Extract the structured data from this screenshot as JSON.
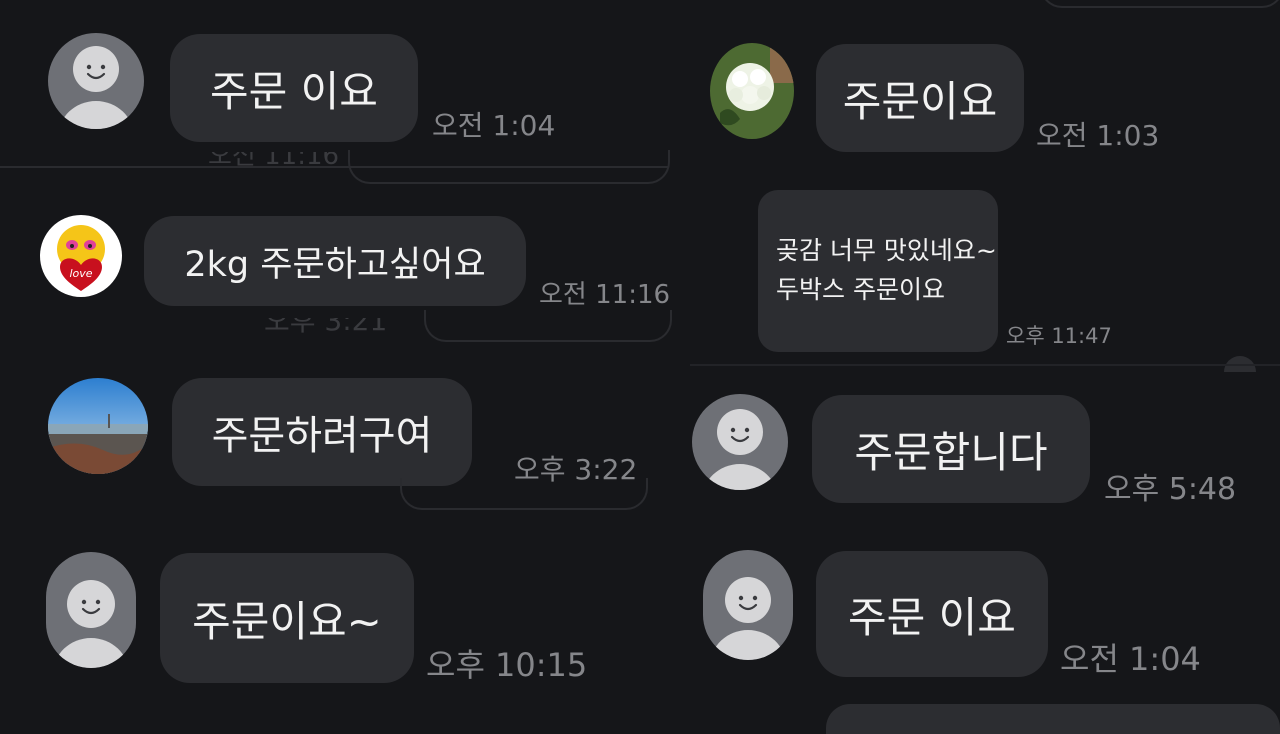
{
  "colors": {
    "background": "#151619",
    "bubble": "#2c2d31",
    "bubble_text": "#f2f2f2",
    "timestamp": "#85868a",
    "default_avatar": "#6e7076"
  },
  "left": {
    "messages": [
      {
        "text": "주문 이요",
        "time": "오전 1:04",
        "avatar": "default-person-icon"
      },
      {
        "text": "2kg 주문하고싶어요",
        "time": "오전 11:16",
        "avatar": "love-heart-emoji"
      },
      {
        "text": "주문하려구여",
        "time": "오후 3:22",
        "avatar": "city-view-photo"
      },
      {
        "text": "주문이요~",
        "time": "오후 10:15",
        "avatar": "default-person-icon"
      }
    ],
    "cut_off": [
      "오전 11:16",
      "오후 3:21"
    ]
  },
  "right": {
    "messages": [
      {
        "text": "주문이요",
        "time": "오전 1:03",
        "avatar": "white-flower-photo"
      },
      {
        "text": "곶감 너무 맛있네요~\n두박스 주문이요",
        "time": "오후 11:47",
        "avatar": ""
      },
      {
        "text": "주문합니다",
        "time": "오후 5:48",
        "avatar": "default-person-icon"
      },
      {
        "text": "주문 이요",
        "time": "오전 1:04",
        "avatar": "default-person-icon"
      }
    ]
  }
}
